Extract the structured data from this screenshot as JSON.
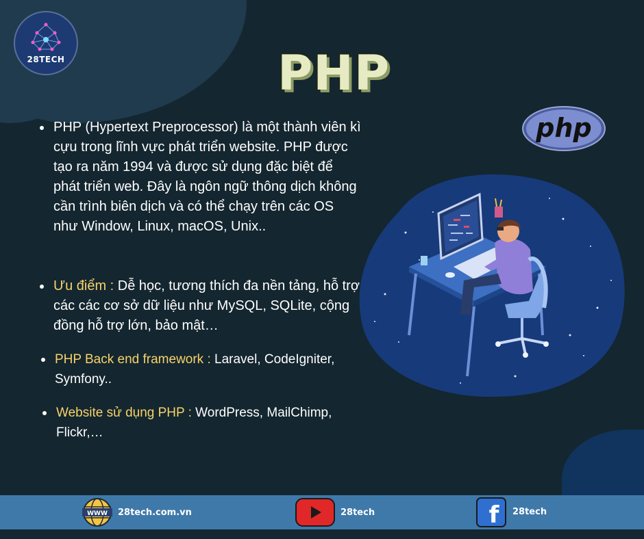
{
  "logo": {
    "name": "28TECH"
  },
  "title": "PHP",
  "php_logo_text": "php",
  "bullets": {
    "item1_text": "PHP (Hypertext Preprocessor) là một thành viên kì cựu trong lĩnh vực phát triển website. PHP được tạo ra năm 1994 và được sử dụng đặc biệt để phát triển web. Đây là ngôn ngữ thông dịch không cần trình biên dịch và có thể chạy trên các OS như Window, Linux, macOS, Unix..",
    "item2_label": "Ưu điểm :",
    "item2_text": " Dễ học, tương thích đa nền tảng, hỗ trợ các các cơ sở dữ liệu như MySQL, SQLite, cộng đồng hỗ trợ lớn, bảo mật…",
    "item3_label": "PHP Back end framework :",
    "item3_text": " Laravel, CodeIgniter, Symfony..",
    "item4_label": "Website sử dụng PHP :",
    "item4_text": " WordPress, MailChimp, Flickr,…"
  },
  "footer": {
    "website_badge": "WWW",
    "website": "28tech.com.vn",
    "youtube": "28tech",
    "facebook": "28tech",
    "facebook_letter": "f"
  }
}
